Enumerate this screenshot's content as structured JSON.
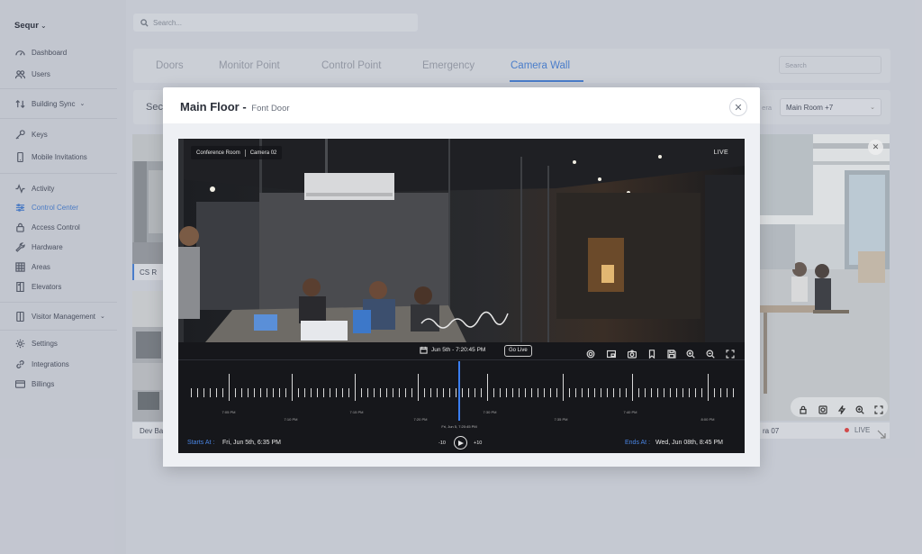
{
  "app": {
    "name": "Sequr"
  },
  "search": {
    "placeholder": "Search..."
  },
  "sidebar": {
    "items": [
      {
        "label": "Dashboard",
        "icon": "dashboard-icon"
      },
      {
        "label": "Users",
        "icon": "users-icon"
      },
      {
        "label": "Building Sync",
        "icon": "sync-icon"
      },
      {
        "label": "Keys",
        "icon": "key-icon"
      },
      {
        "label": "Mobile Invitations",
        "icon": "mobile-icon"
      },
      {
        "label": "Activity",
        "icon": "activity-icon"
      },
      {
        "label": "Control Center",
        "icon": "control-center-icon",
        "active": true
      },
      {
        "label": "Access Control",
        "icon": "lock-icon"
      },
      {
        "label": "Hardware",
        "icon": "wrench-icon"
      },
      {
        "label": "Areas",
        "icon": "grid-icon"
      },
      {
        "label": "Elevators",
        "icon": "elevator-icon"
      },
      {
        "label": "Visitor Management",
        "icon": "visitor-icon"
      },
      {
        "label": "Settings",
        "icon": "gear-icon"
      },
      {
        "label": "Integrations",
        "icon": "link-icon"
      },
      {
        "label": "Billings",
        "icon": "card-icon"
      }
    ]
  },
  "tabs": {
    "items": [
      "Doors",
      "Monitor Point",
      "Control Point",
      "Emergency",
      "Camera Wall"
    ],
    "active": "Camera Wall",
    "search_placeholder": "Search"
  },
  "second_bar": {
    "label": "Sec",
    "camera_label": "era",
    "room_select": "Main Room +7"
  },
  "tiles": {
    "left_top_label": "CS R",
    "left_bottom_label": "Dev Ba",
    "right_label": "ra 07",
    "right_live": "LIVE"
  },
  "modal": {
    "title": "Main Floor -",
    "subtitle": "Font Door",
    "close": "✕",
    "camera_room": "Conference Room",
    "camera_name": "Camera 02",
    "live": "LIVE",
    "date_time": "Jun 5th -  7:20:45 PM",
    "go_live": "Go Live",
    "tick_labels": [
      "7:05 PM",
      "7:10 PM",
      "7:15 PM",
      "7:20 PM",
      "7:30 PM",
      "7:35 PM",
      "7:40 PM",
      "8:00 PM",
      "8:10 PM"
    ],
    "playhead_label": "Fri, Jun 5, 7:20:45 PM",
    "starts_label": "Starts At :",
    "starts_value": "Fri, Jun 5th, 6:35 PM",
    "ends_label": "Ends At :",
    "ends_value": "Wed, Jun 08th, 8:45 PM",
    "skip_back": "-10",
    "skip_forward": "+10"
  },
  "colors": {
    "accent": "#4a82d6",
    "player_bg": "#16171b",
    "playhead": "#3a7ef0",
    "live_dot": "#e04848"
  }
}
